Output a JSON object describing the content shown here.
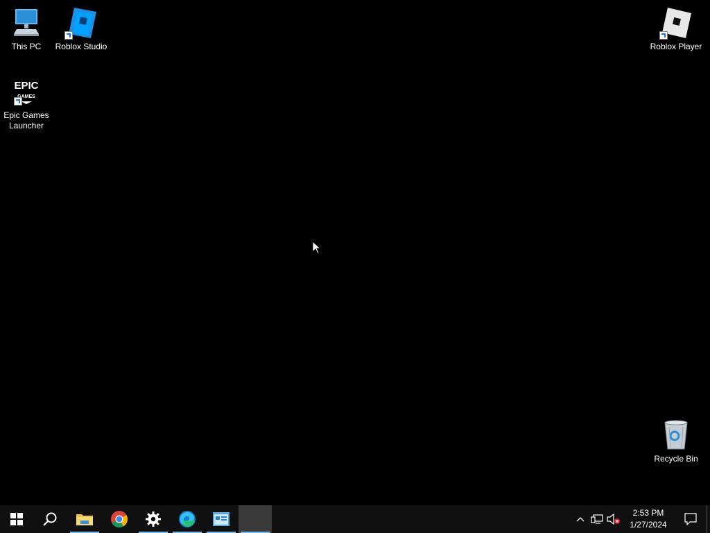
{
  "desktop": {
    "icons": [
      {
        "label": "This PC",
        "icon": "this-pc-icon"
      },
      {
        "label": "Roblox Studio",
        "icon": "roblox-studio-icon"
      },
      {
        "label": "Roblox Player",
        "icon": "roblox-player-icon"
      },
      {
        "label": "Epic Games Launcher",
        "icon": "epic-games-icon",
        "logo_text_top": "EPIC",
        "logo_text_bottom": "GAMES"
      },
      {
        "label": "Recycle Bin",
        "icon": "recycle-bin-icon"
      }
    ]
  },
  "taskbar": {
    "pinned": [
      {
        "name": "start",
        "icon": "windows-logo-icon"
      },
      {
        "name": "search",
        "icon": "search-icon"
      },
      {
        "name": "file-explorer",
        "icon": "folder-icon",
        "running": true
      },
      {
        "name": "chrome",
        "icon": "chrome-icon"
      },
      {
        "name": "settings",
        "icon": "gear-icon",
        "running": true
      },
      {
        "name": "edge",
        "icon": "edge-icon",
        "running": true
      },
      {
        "name": "app",
        "icon": "app-window-icon",
        "running": true
      },
      {
        "name": "active-window",
        "icon": "blank",
        "active": true
      }
    ],
    "tray": {
      "time": "2:53 PM",
      "date": "1/27/2024"
    }
  },
  "colors": {
    "desktop_bg": "#000000",
    "taskbar_bg": "#101010",
    "accent": "#76b9ed"
  }
}
